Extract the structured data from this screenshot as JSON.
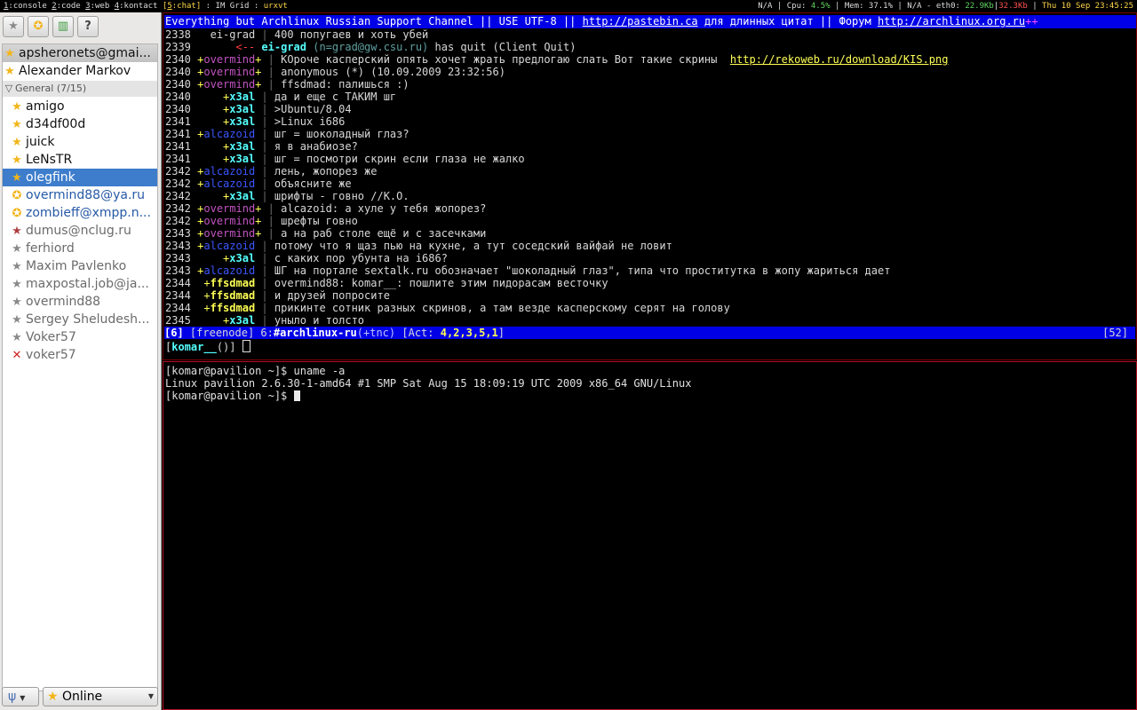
{
  "topbar": {
    "workspaces": [
      {
        "num": "1",
        "name": "console"
      },
      {
        "num": "2",
        "name": "code"
      },
      {
        "num": "3",
        "name": "web"
      },
      {
        "num": "4",
        "name": "kontact"
      },
      {
        "num": "5",
        "name": "chat",
        "active": true
      }
    ],
    "layout": "IM Grid",
    "window_title": "urxvt",
    "status": {
      "na1": "N/A",
      "cpu_label": "Cpu:",
      "cpu": "4.5%",
      "mem_label": "Mem:",
      "mem": "37.1%",
      "na2": "N/A",
      "net_label": "eth0:",
      "down": "22.9Kb",
      "up": "32.3Kb",
      "datetime": "Thu 10 Sep 23:45:25"
    }
  },
  "roster": {
    "account": "apsheronets@gmai...",
    "top_contact": "Alexander Markov",
    "group": {
      "name": "General",
      "count": "(7/15)"
    },
    "contacts": [
      {
        "name": "amigo",
        "status": "online"
      },
      {
        "name": "d34df00d",
        "status": "online"
      },
      {
        "name": "juick",
        "status": "online"
      },
      {
        "name": "LeNsTR",
        "status": "online"
      },
      {
        "name": "olegfink",
        "status": "selected"
      },
      {
        "name": "overmind88@ya.ru",
        "status": "transport"
      },
      {
        "name": "zombieff@xmpp.n...",
        "status": "transport"
      },
      {
        "name": "dumus@nclug.ru",
        "status": "offline-special"
      },
      {
        "name": "ferhiord",
        "status": "offline"
      },
      {
        "name": "Maxim Pavlenko",
        "status": "offline"
      },
      {
        "name": "maxpostal.job@ja...",
        "status": "offline"
      },
      {
        "name": "overmind88",
        "status": "offline"
      },
      {
        "name": "Sergey Sheludesh...",
        "status": "offline"
      },
      {
        "name": "Voker57",
        "status": "offline"
      },
      {
        "name": "voker57",
        "status": "error"
      }
    ],
    "status_combo": "Online"
  },
  "irc": {
    "topic_parts": {
      "a": "Everything but Archlinux Russian Support Channel || USE UTF-8 || ",
      "link1": "http://pastebin.ca",
      "b": " для длинных цитат || Форум ",
      "link2": "http://archlinux.org.ru",
      "plus": "++"
    },
    "lines": [
      {
        "ts": "2338",
        "nick": "ei-grad",
        "kind": "eig",
        "mode": " ",
        "text": "400 попугаев и хоть убей"
      },
      {
        "ts": "2339",
        "kind": "quit",
        "arrow": "<--",
        "nick": "ei-grad",
        "host": "(n=grad@gw.csu.ru)",
        "text": "has quit (Client Quit)"
      },
      {
        "ts": "2340",
        "nick": "overmind",
        "kind": "over",
        "mode": "+",
        "text": "КОроче касперский опять хочет жрать предлогаю слать Вот такие скрины  ",
        "url": "http://rekoweb.ru/download/KIS.png"
      },
      {
        "ts": "2340",
        "nick": "overmind",
        "kind": "over",
        "mode": "+",
        "text": "anonymous (*) (10.09.2009 23:32:56)"
      },
      {
        "ts": "2340",
        "nick": "overmind",
        "kind": "over",
        "mode": "+",
        "text": "ffsdmad: палишься :)"
      },
      {
        "ts": "2340",
        "nick": "x3al",
        "kind": "x3al",
        "mode": "+",
        "text": "да и еще с ТАКИМ шг"
      },
      {
        "ts": "2340",
        "nick": "x3al",
        "kind": "x3al",
        "mode": "+",
        "text": ">Ubuntu/8.04"
      },
      {
        "ts": "2341",
        "nick": "x3al",
        "kind": "x3al",
        "mode": "+",
        "text": ">Linux i686"
      },
      {
        "ts": "2341",
        "nick": "alcazoid",
        "kind": "alc",
        "mode": "+",
        "text": "шг = шоколадный глаз?"
      },
      {
        "ts": "2341",
        "nick": "x3al",
        "kind": "x3al",
        "mode": "+",
        "text": "я в анабиозе?"
      },
      {
        "ts": "2341",
        "nick": "x3al",
        "kind": "x3al",
        "mode": "+",
        "text": "шг = посмотри скрин если глаза не жалко"
      },
      {
        "ts": "2342",
        "nick": "alcazoid",
        "kind": "alc",
        "mode": "+",
        "text": "лень, жопорез же"
      },
      {
        "ts": "2342",
        "nick": "alcazoid",
        "kind": "alc",
        "mode": "+",
        "text": "объясните же"
      },
      {
        "ts": "2342",
        "nick": "x3al",
        "kind": "x3al",
        "mode": "+",
        "text": "шрифты - говно //K.O."
      },
      {
        "ts": "2342",
        "nick": "overmind",
        "kind": "over",
        "mode": "+",
        "text": "alcazoid: а хуле у тебя жопорез?"
      },
      {
        "ts": "2342",
        "nick": "overmind",
        "kind": "over",
        "mode": "+",
        "text": "шрефты говно"
      },
      {
        "ts": "2343",
        "nick": "overmind",
        "kind": "over",
        "mode": "+",
        "text": "а на раб столе ещё и с засечками"
      },
      {
        "ts": "2343",
        "nick": "alcazoid",
        "kind": "alc",
        "mode": "+",
        "text": "потому что я щаз пью на кухне, а тут соседский вайфай не ловит"
      },
      {
        "ts": "2343",
        "nick": "x3al",
        "kind": "x3al",
        "mode": "+",
        "text": "с каких пор убунта на i686?"
      },
      {
        "ts": "2343",
        "nick": "alcazoid",
        "kind": "alc",
        "mode": "+",
        "text": "ШГ на портале sextalk.ru обозначает \"шоколадный глаз\", типа что проститутка в жопу жариться дает"
      },
      {
        "ts": "2344",
        "nick": "ffsdmad",
        "kind": "ffs",
        "mode": "+",
        "text": "overmind88: komar__: пошлите этим пидорасам весточку"
      },
      {
        "ts": "2344",
        "nick": "ffsdmad",
        "kind": "ffs",
        "mode": "+",
        "text": "и друзей попросите"
      },
      {
        "ts": "2344",
        "nick": "ffsdmad",
        "kind": "ffs",
        "mode": "+",
        "text": "прикинте сотник разных скринов, а там везде касперскому серят на голову"
      },
      {
        "ts": "2345",
        "nick": "x3al",
        "kind": "x3al",
        "mode": "+",
        "text": "уныло и толсто"
      }
    ],
    "status": {
      "win": "[6]",
      "net": "[freenode]",
      "chan_num": "6:",
      "chan": "#archlinux-ru",
      "mode": "(+tnc)",
      "act_label": "[Act:",
      "act": "4,2,3,5,1",
      "act_close": "]",
      "right": "[52]"
    },
    "prompt_nick": "komar__",
    "prompt_suffix": "()"
  },
  "shell": {
    "lines": [
      "[komar@pavilion ~]$ uname -a",
      "Linux pavilion 2.6.30-1-amd64 #1 SMP Sat Aug 15 18:09:19 UTC 2009 x86_64 GNU/Linux",
      "[komar@pavilion ~]$ "
    ]
  }
}
